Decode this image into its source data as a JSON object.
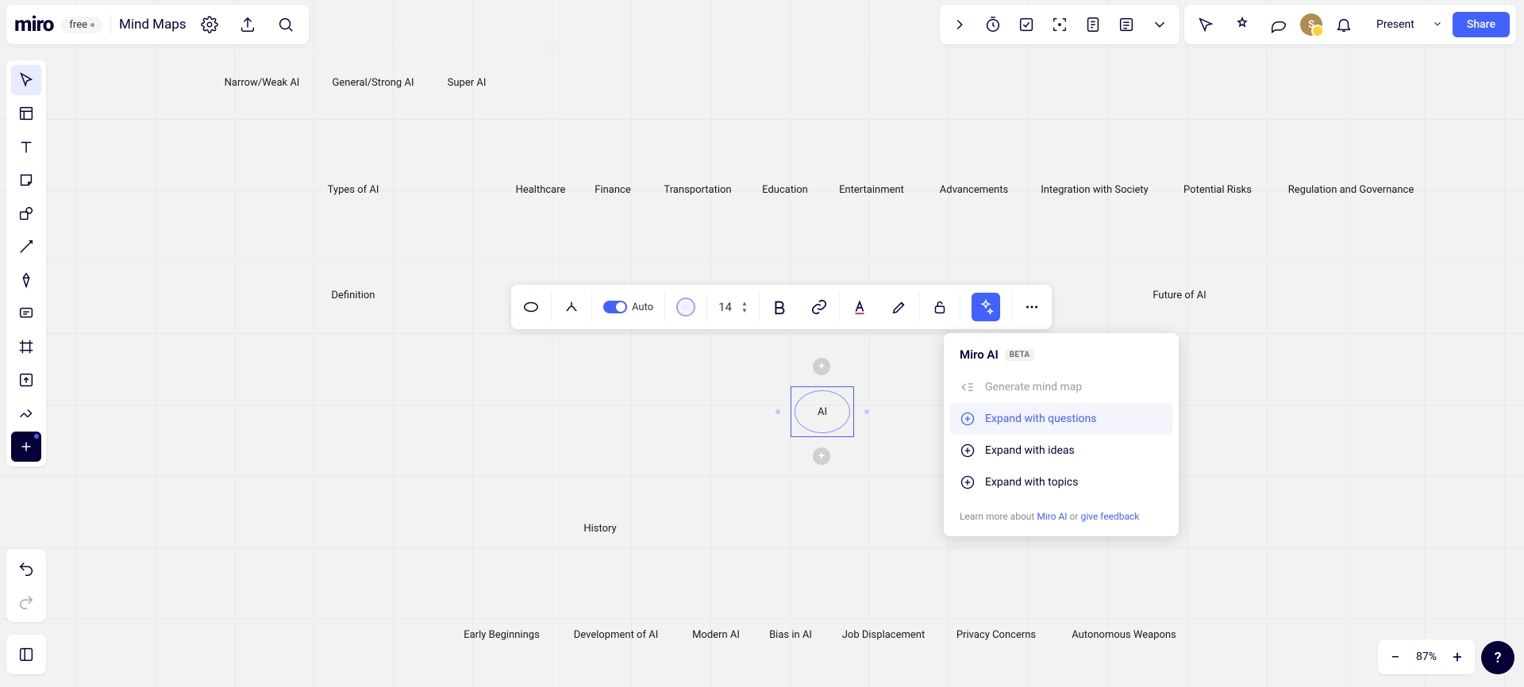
{
  "app": {
    "logo": "miro",
    "plan": "free",
    "board_title": "Mind Maps"
  },
  "topbar_right_b": {
    "avatar_initial": "S",
    "present_label": "Present",
    "share_label": "Share"
  },
  "mindmap": {
    "center": "AI",
    "types_parent": "Types of AI",
    "types": [
      "Narrow/Weak AI",
      "General/Strong AI",
      "Super AI"
    ],
    "definition": "Definition",
    "apps": [
      "Healthcare",
      "Finance",
      "Transportation",
      "Education",
      "Entertainment"
    ],
    "future_parent": "Future of AI",
    "future": [
      "Advancements",
      "Integration with Society",
      "Potential Risks",
      "Regulation and Governance"
    ],
    "history_parent": "History",
    "history": [
      "Early Beginnings",
      "Development of AI",
      "Modern AI"
    ],
    "ethics": [
      "Bias in AI",
      "Job Displacement",
      "Privacy Concerns",
      "Autonomous Weapons"
    ]
  },
  "ctx": {
    "auto": "Auto",
    "font_size": "14"
  },
  "ai_popover": {
    "title": "Miro AI",
    "badge": "BETA",
    "generate": "Generate mind map",
    "expand_q": "Expand with questions",
    "expand_i": "Expand with ideas",
    "expand_t": "Expand with topics",
    "foot_prefix": "Learn more about ",
    "foot_link1": "Miro AI",
    "foot_mid": " or ",
    "foot_link2": "give feedback"
  },
  "zoom": {
    "percent": "87%"
  }
}
